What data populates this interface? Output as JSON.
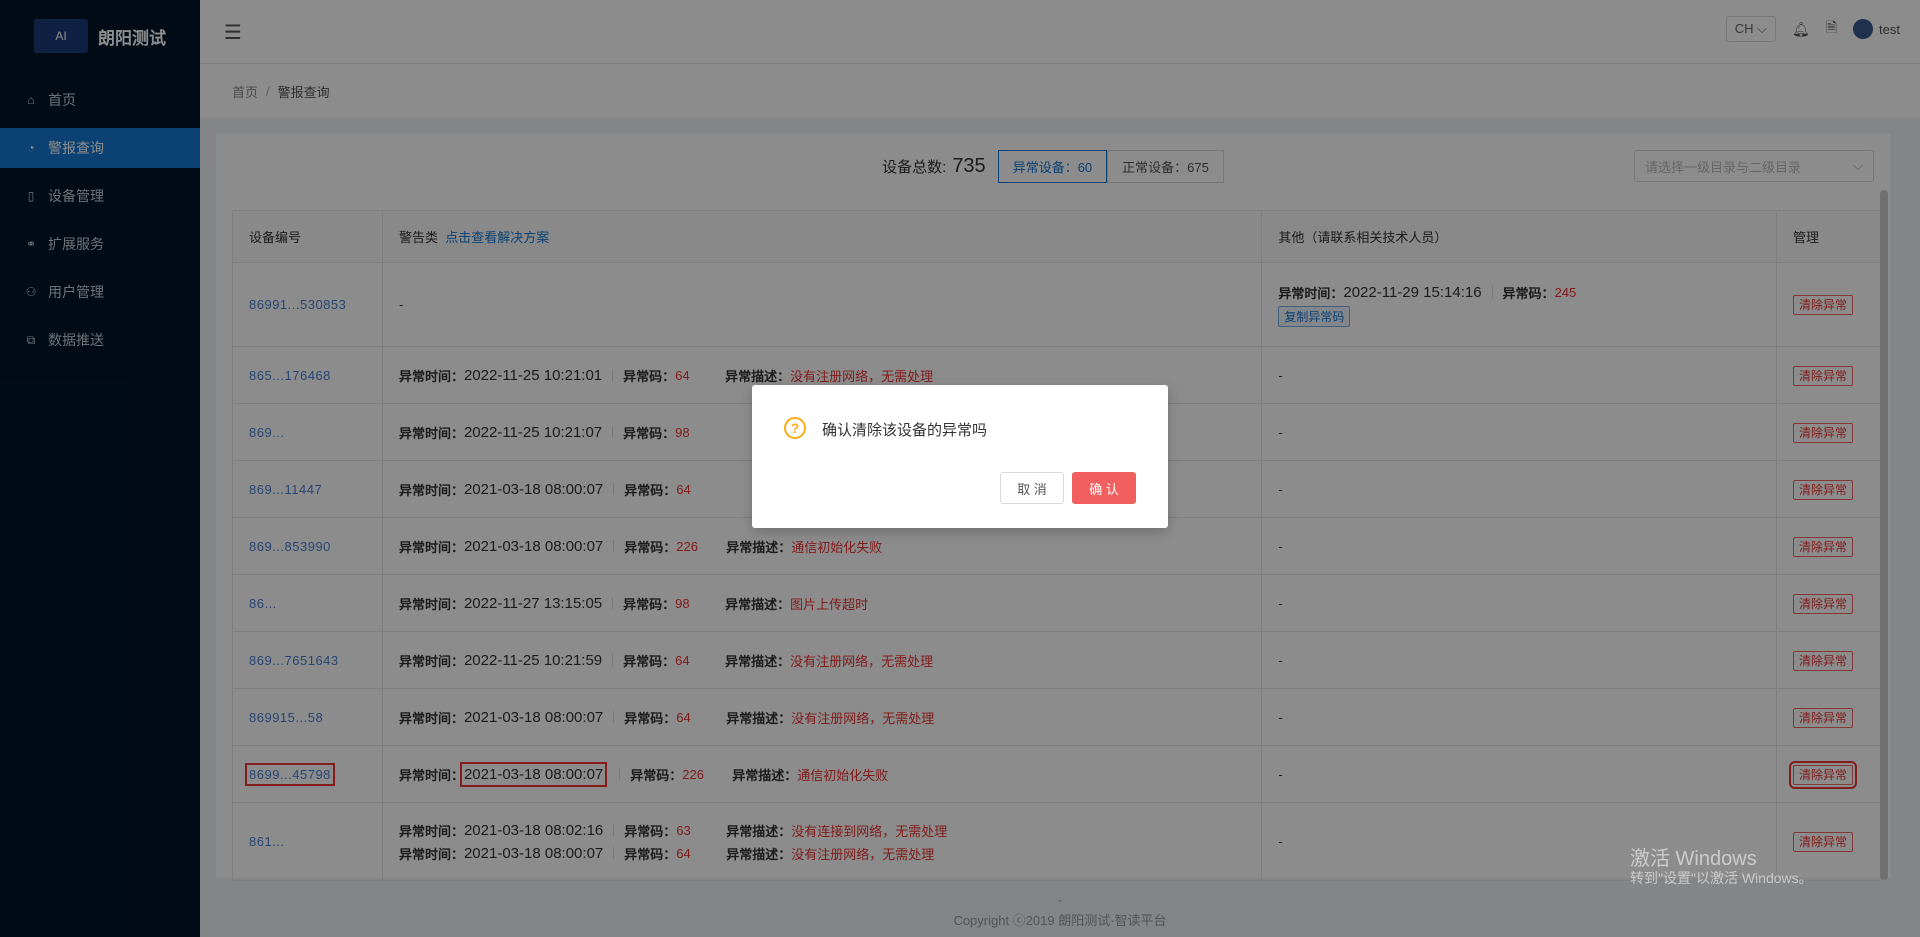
{
  "sidebar": {
    "logo_mark": "AI",
    "logo_text": "朗阳测试",
    "items": [
      {
        "label": "首页",
        "icon": "home-icon"
      },
      {
        "label": "警报查询",
        "icon": "dashboard-icon"
      },
      {
        "label": "设备管理",
        "icon": "tablet-icon"
      },
      {
        "label": "扩展服务",
        "icon": "link-icon"
      },
      {
        "label": "用户管理",
        "icon": "user-icon"
      },
      {
        "label": "数据推送",
        "icon": "copy-icon"
      }
    ]
  },
  "header": {
    "lang": "CH",
    "user": "test"
  },
  "breadcrumb": {
    "home": "首页",
    "current": "警报查询"
  },
  "summary": {
    "total_label": "设备总数:",
    "total_value": "735",
    "abnormal": "异常设备：60",
    "normal": "正常设备：675",
    "category_placeholder": "请选择一级目录与二级目录"
  },
  "table": {
    "headers": {
      "device": "设备编号",
      "alarm": "警告类",
      "alarm_link": "点击查看解决方案",
      "other": "其他（请联系相关技术人员）",
      "manage": "管理"
    },
    "labels": {
      "time": "异常时间：",
      "code": "异常码：",
      "desc": "异常描述：",
      "clear": "清除异常",
      "copy": "复制异常码"
    },
    "rows": [
      {
        "device": "86991...530853",
        "alarm": "-",
        "other_time": "2022-11-29 15:14:16",
        "other_code": "245"
      },
      {
        "device": "865...176468",
        "time": "2022-11-25 10:21:01",
        "code": "64",
        "desc": "没有注册网络，无需处理",
        "other": "-"
      },
      {
        "device": "869...",
        "time": "2022-11-25 10:21:07",
        "code": "98",
        "desc": "",
        "other": "-"
      },
      {
        "device": "869...11447",
        "time": "2021-03-18 08:00:07",
        "code": "64",
        "desc": "",
        "other": "-"
      },
      {
        "device": "869...853990",
        "time": "2021-03-18 08:00:07",
        "code": "226",
        "desc": "通信初始化失败",
        "other": "-"
      },
      {
        "device": "86...",
        "time": "2022-11-27 13:15:05",
        "code": "98",
        "desc": "图片上传超时",
        "other": "-"
      },
      {
        "device": "869...7651643",
        "time": "2022-11-25 10:21:59",
        "code": "64",
        "desc": "没有注册网络，无需处理",
        "other": "-"
      },
      {
        "device": "869915...58",
        "time": "2021-03-18 08:00:07",
        "code": "64",
        "desc": "没有注册网络，无需处理",
        "other": "-"
      },
      {
        "device": "8699...45798",
        "time": "2021-03-18 08:00:07",
        "code": "226",
        "desc": "通信初始化失败",
        "other": "-"
      },
      {
        "device": "861...",
        "time": "2021-03-18 08:02:16",
        "code": "63",
        "desc": "没有连接到网络，无需处理",
        "time2": "2021-03-18 08:00:07",
        "code2": "64",
        "desc2": "没有注册网络，无需处理",
        "other": "-"
      }
    ]
  },
  "footer": {
    "dash": "-",
    "copyright": "Copyright ⓒ2019 朗阳测试·智读平台"
  },
  "modal": {
    "message": "确认清除该设备的异常吗",
    "cancel": "取 消",
    "ok": "确 认"
  },
  "watermark": {
    "line1": "激活 Windows",
    "line2": "转到\"设置\"以激活 Windows。"
  },
  "colors": {
    "accent": "#1677d2",
    "danger": "#e33333",
    "sidebar": "#001529",
    "warning": "#faad14"
  }
}
